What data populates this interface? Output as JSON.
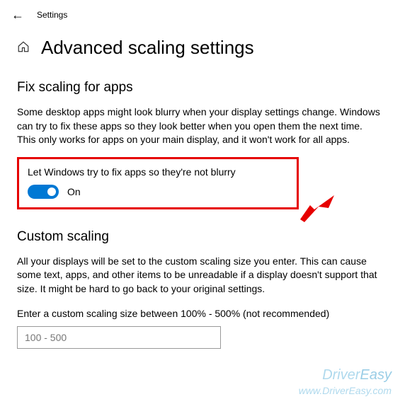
{
  "header": {
    "back_icon": "←",
    "title": "Settings"
  },
  "page": {
    "title": "Advanced scaling settings"
  },
  "fix_scaling": {
    "section_title": "Fix scaling for apps",
    "description": "Some desktop apps might look blurry when your display settings change. Windows can try to fix these apps so they look better when you open them the next time. This only works for apps on your main display, and it won't work for all apps.",
    "toggle_label": "Let Windows try to fix apps so they're not blurry",
    "toggle_state": "On"
  },
  "custom_scaling": {
    "section_title": "Custom scaling",
    "description": "All your displays will be set to the custom scaling size you enter. This can cause some text, apps, and other items to be unreadable if a display doesn't support that size. It might be hard to go back to your original settings.",
    "input_label": "Enter a custom scaling size between 100% - 500% (not recommended)",
    "input_placeholder": "100 - 500"
  },
  "watermark": {
    "brand_driver": "Driver",
    "brand_easy": "Easy",
    "url": "www.DriverEasy.com"
  }
}
